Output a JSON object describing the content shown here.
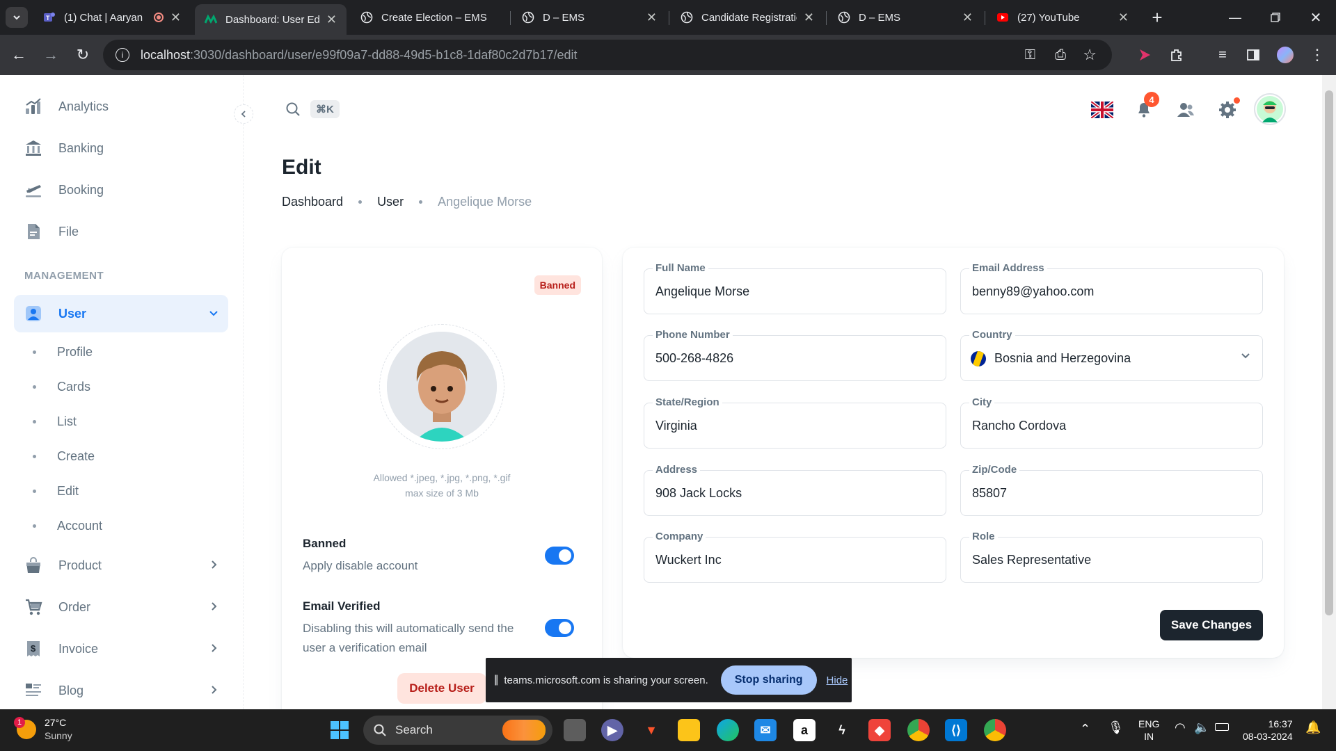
{
  "browser": {
    "tabs": [
      {
        "title": "(1) Chat | Aaryan",
        "active": false
      },
      {
        "title": "Dashboard: User Edit",
        "active": true
      },
      {
        "title": "Create Election – EMS",
        "active": false
      },
      {
        "title": "D – EMS",
        "active": false
      },
      {
        "title": "Candidate Registration",
        "active": false
      },
      {
        "title": "D – EMS",
        "active": false
      },
      {
        "title": "(27) YouTube",
        "active": false
      }
    ],
    "url_host": "localhost",
    "url_path": ":3030/dashboard/user/e99f09a7-dd88-49d5-b1c8-1daf80c2d7b17/edit"
  },
  "sidebar": {
    "top_items": [
      {
        "label": "Analytics",
        "icon": "analytics-icon"
      },
      {
        "label": "Banking",
        "icon": "bank-icon"
      },
      {
        "label": "Booking",
        "icon": "plane-icon"
      },
      {
        "label": "File",
        "icon": "file-icon"
      }
    ],
    "section_label": "MANAGEMENT",
    "user_item": {
      "label": "User"
    },
    "user_subitems": [
      {
        "label": "Profile"
      },
      {
        "label": "Cards"
      },
      {
        "label": "List"
      },
      {
        "label": "Create"
      },
      {
        "label": "Edit"
      },
      {
        "label": "Account"
      }
    ],
    "more_items": [
      {
        "label": "Product",
        "icon": "bag-icon"
      },
      {
        "label": "Order",
        "icon": "cart-icon"
      },
      {
        "label": "Invoice",
        "icon": "invoice-icon"
      },
      {
        "label": "Blog",
        "icon": "blog-icon"
      }
    ]
  },
  "header": {
    "shortcut": "⌘K",
    "notifications_count": "4"
  },
  "page": {
    "title": "Edit",
    "breadcrumb": [
      "Dashboard",
      "User",
      "Angelique Morse"
    ]
  },
  "profile_card": {
    "status_badge": "Banned",
    "allowed_line1": "Allowed *.jpeg, *.jpg, *.png, *.gif",
    "allowed_line2": "max size of 3 Mb",
    "banned_title": "Banned",
    "banned_desc": "Apply disable account",
    "banned_on": true,
    "verified_title": "Email Verified",
    "verified_desc": "Disabling this will automatically send the user a verification email",
    "verified_on": true,
    "delete_label": "Delete User"
  },
  "form": {
    "full_name": {
      "label": "Full Name",
      "value": "Angelique Morse"
    },
    "email": {
      "label": "Email Address",
      "value": "benny89@yahoo.com"
    },
    "phone": {
      "label": "Phone Number",
      "value": "500-268-4826"
    },
    "country": {
      "label": "Country",
      "value": "Bosnia and Herzegovina"
    },
    "state": {
      "label": "State/Region",
      "value": "Virginia"
    },
    "city": {
      "label": "City",
      "value": "Rancho Cordova"
    },
    "address": {
      "label": "Address",
      "value": "908 Jack Locks"
    },
    "zip": {
      "label": "Zip/Code",
      "value": "85807"
    },
    "company": {
      "label": "Company",
      "value": "Wuckert Inc"
    },
    "role": {
      "label": "Role",
      "value": "Sales Representative"
    },
    "save_label": "Save Changes"
  },
  "sharing": {
    "message": "teams.microsoft.com is sharing your screen.",
    "stop_label": "Stop sharing",
    "hide_label": "Hide"
  },
  "taskbar": {
    "weather_temp": "27°C",
    "weather_desc": "Sunny",
    "weather_badge": "1",
    "search_label": "Search",
    "lang_top": "ENG",
    "lang_bottom": "IN",
    "time": "16:37",
    "date": "08-03-2024"
  },
  "colors": {
    "primary": "#1877f2",
    "danger": "#b71d18",
    "dark": "#1c252e"
  }
}
